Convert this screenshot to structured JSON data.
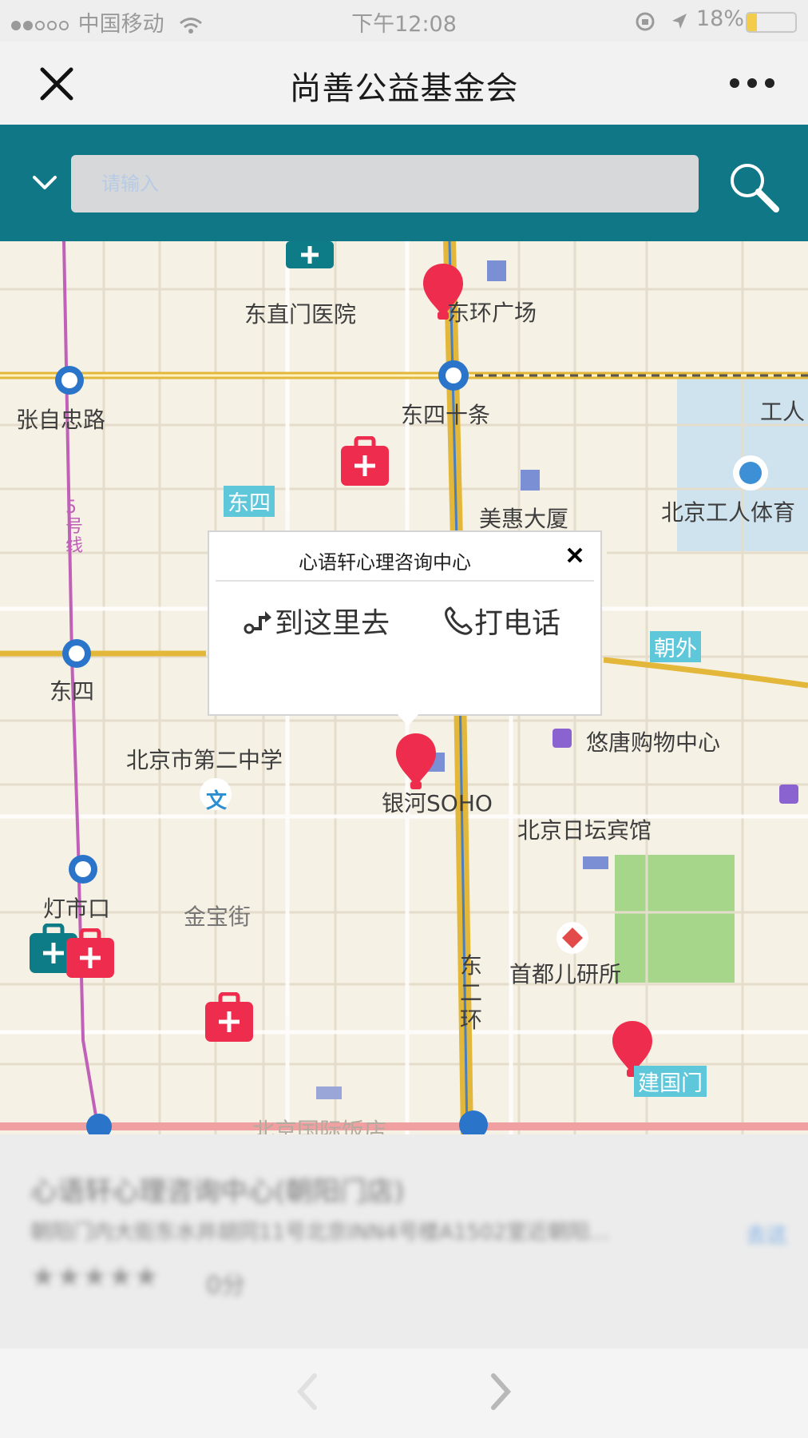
{
  "status_bar": {
    "carrier": "中国移动",
    "time": "下午12:08",
    "battery": "18%"
  },
  "title_bar": {
    "title": "尚善公益基金会"
  },
  "search": {
    "placeholder": "请输入"
  },
  "map": {
    "labels": {
      "dongzhimen_hospital": "东直门医院",
      "donghuan_plaza": "东环广场",
      "zhangzizhong_road": "张自忠路",
      "dongsishitiao": "东四十条",
      "gongren": "工人",
      "meihui_building": "美惠大厦",
      "beijing_workers_stadium": "北京工人体育",
      "dongsi_station": "东四",
      "beijing_no2_middle_school": "北京市第二中学",
      "youtang_mall": "悠唐购物中心",
      "yinhe_soho": "银河SOHO",
      "beijing_ritan_hotel": "北京日坛宾馆",
      "dengshikou": "灯市口",
      "jinbao_street": "金宝街",
      "capital_pediatrics": "首都儿研所",
      "east_2nd_ring": "东二环",
      "beijing_intl_hotel": "北京国际饭店"
    },
    "tags": {
      "dongsi": "东四",
      "chaowai": "朝外",
      "jianguomen": "建国门"
    },
    "line5_label": "5号线"
  },
  "popup": {
    "title": "心语轩心理咨询中心",
    "navigate_label": "到这里去",
    "call_label": "打电话",
    "close_icon": "close-icon"
  },
  "info_panel": {
    "name": "心语轩心理咨询中心(朝阳门店)",
    "address": "朝阳门内大街东水井胡同11号北京INN4号楼A1502室近朝阳...",
    "rating": "0分",
    "action": "去这"
  },
  "colors": {
    "teal": "#0f7786",
    "marker_red": "#ee2c4d",
    "medical_teal": "#0e7c86",
    "road_yellow": "#e3b73a",
    "park_green": "#a6d68a",
    "water_blue": "#cfe3ef"
  }
}
